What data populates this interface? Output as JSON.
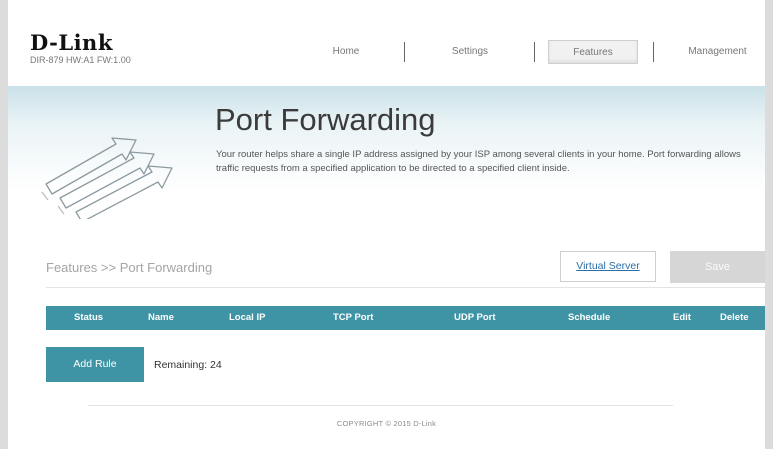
{
  "header": {
    "logo": "D-Link",
    "device_info": "DIR-879 HW:A1 FW:1.00",
    "nav": [
      {
        "label": "Home"
      },
      {
        "label": "Settings"
      },
      {
        "label": "Features"
      },
      {
        "label": "Management"
      }
    ],
    "active_nav": "Features"
  },
  "banner": {
    "title": "Port Forwarding",
    "description": "Your router helps share a single IP address assigned by your ISP among several clients in your home. Port forwarding allows traffic requests from a specified application to be directed to a specified client inside.",
    "icon": "port-forwarding-arrows-icon"
  },
  "toolbar": {
    "breadcrumb": "Features >> Port Forwarding",
    "virtual_server_label": "Virtual Server",
    "save_label": "Save"
  },
  "table": {
    "columns": [
      "Status",
      "Name",
      "Local IP",
      "TCP Port",
      "UDP Port",
      "Schedule",
      "Edit",
      "Delete"
    ],
    "rows": []
  },
  "actions": {
    "add_rule_label": "Add Rule",
    "remaining_label": "Remaining: 24"
  },
  "footer": {
    "copyright": "COPYRIGHT © 2015 D-Link"
  },
  "colors": {
    "accent": "#3e94a5",
    "save_disabled": "#d6d6d6",
    "link": "#2c6ea7"
  }
}
